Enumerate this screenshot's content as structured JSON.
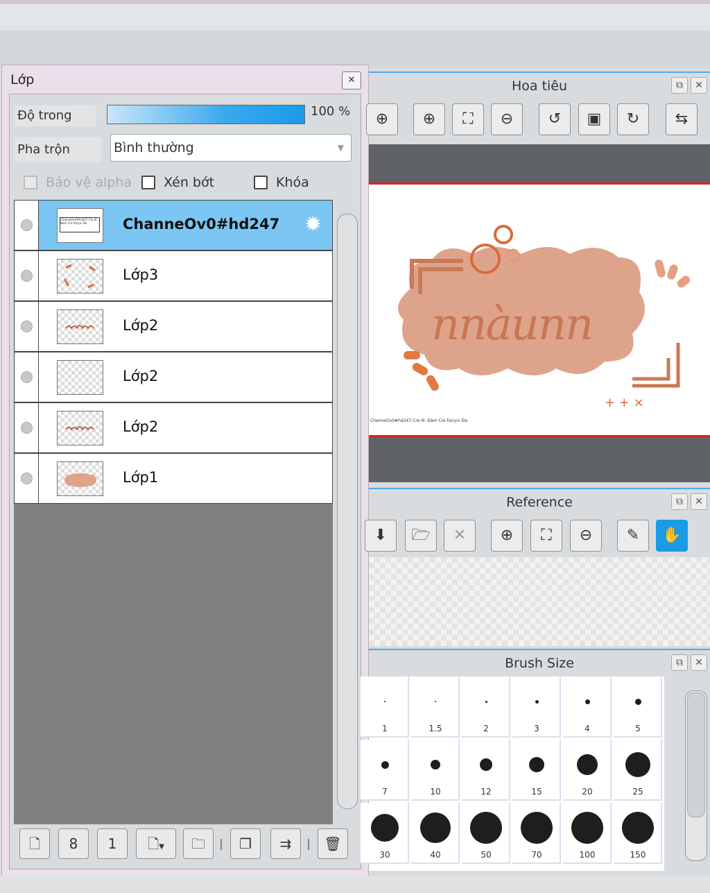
{
  "layer_panel": {
    "title": "Lớp",
    "close_icon": "close-icon",
    "opacity_label": "Độ trong",
    "opacity_value": "100 %",
    "opacity_fraction": 1.0,
    "blend_label": "Pha trộn",
    "blend_value": "Bình thường",
    "checkboxes": {
      "protect_alpha": "Bảo vệ alpha",
      "clip": "Xén bớt",
      "lock": "Khóa"
    },
    "layers": [
      {
        "name": "ChanneOv0#hd247",
        "selected": true
      },
      {
        "name": "Lớp3",
        "selected": false
      },
      {
        "name": "Lớp2",
        "selected": false
      },
      {
        "name": "Lớp2",
        "selected": false
      },
      {
        "name": "Lớp2",
        "selected": false
      },
      {
        "name": "Lớp1",
        "selected": false
      }
    ],
    "thumb_caption": "ChanneOv0#hd247 Cre ới: Đàm Cre fairyư: Đa",
    "buttons": [
      "new-layer-icon",
      "8bit-layer-icon",
      "1bit-layer-icon",
      "add-layer-menu-icon",
      "folder-icon",
      "duplicate-icon",
      "merge-down-icon",
      "delete-icon"
    ],
    "button_glyphs": [
      "🗋",
      "8",
      "1",
      "🗋",
      "🗀",
      "❐",
      "⇉",
      "🗑"
    ]
  },
  "navigator": {
    "title": "Hoa tiêu",
    "tools": [
      "zoom-actual-icon",
      "zoom-in-icon",
      "fit-icon",
      "zoom-out-icon",
      "rotate-left-icon",
      "reset-rotation-icon",
      "rotate-right-icon",
      "flip-icon"
    ],
    "tool_glyphs": [
      "⊕",
      "⊕",
      "⛶",
      "⊖",
      "↺",
      "▣",
      "↻",
      "⇆"
    ],
    "canvas_text": "nnàunn",
    "canvas_caption": "ChanneOv0#hd247 Cre ới: Đàm Cre fairyư: Đa"
  },
  "reference": {
    "title": "Reference",
    "tools": [
      "download-icon",
      "open-folder-icon",
      "close-icon",
      "zoom-in-icon",
      "fit-icon",
      "zoom-out-icon",
      "eyedropper-icon",
      "hand-icon"
    ],
    "tool_glyphs": [
      "⬇",
      "🗁",
      "✕",
      "⊕",
      "⛶",
      "⊖",
      "✎",
      "✋"
    ]
  },
  "brush_size": {
    "title": "Brush Size",
    "sizes": [
      "1",
      "1.5",
      "2",
      "3",
      "4",
      "5",
      "7",
      "10",
      "12",
      "15",
      "20",
      "25",
      "30",
      "40",
      "50",
      "70",
      "100",
      "150"
    ]
  },
  "panel_buttons": {
    "popout": "⧉",
    "close": "✕"
  },
  "colors": {
    "accent": "#1a9be8",
    "selected_layer": "#7bc6f2",
    "canvas_border": "#e02020",
    "art": "#c87654"
  }
}
